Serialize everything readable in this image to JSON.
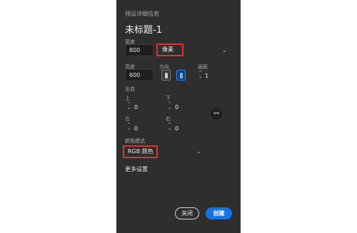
{
  "panel": {
    "section_title": "预设详细信息",
    "doc_title": "未标题-1"
  },
  "width": {
    "label": "宽度",
    "value": "800",
    "unit": "像素"
  },
  "height": {
    "label": "高度",
    "value": "600"
  },
  "orientation": {
    "label": "方向",
    "portrait": "portrait-icon",
    "landscape": "landscape-icon",
    "selected": "landscape"
  },
  "artboards": {
    "label": "画板",
    "value": "1"
  },
  "bleed": {
    "label": "出血",
    "top_label": "上",
    "top_value": "0",
    "bottom_label": "下",
    "bottom_value": "0",
    "left_label": "左",
    "left_value": "0",
    "right_label": "右",
    "right_value": "0"
  },
  "color_mode": {
    "label": "颜色模式",
    "value": "RGB 颜色"
  },
  "more_settings": "更多设置",
  "buttons": {
    "close": "关闭",
    "create": "创建"
  },
  "colors": {
    "panel_bg": "#2e2e2e",
    "highlight": "#e0322f",
    "primary": "#1473e6",
    "landscape_selected": "#2680eb"
  }
}
